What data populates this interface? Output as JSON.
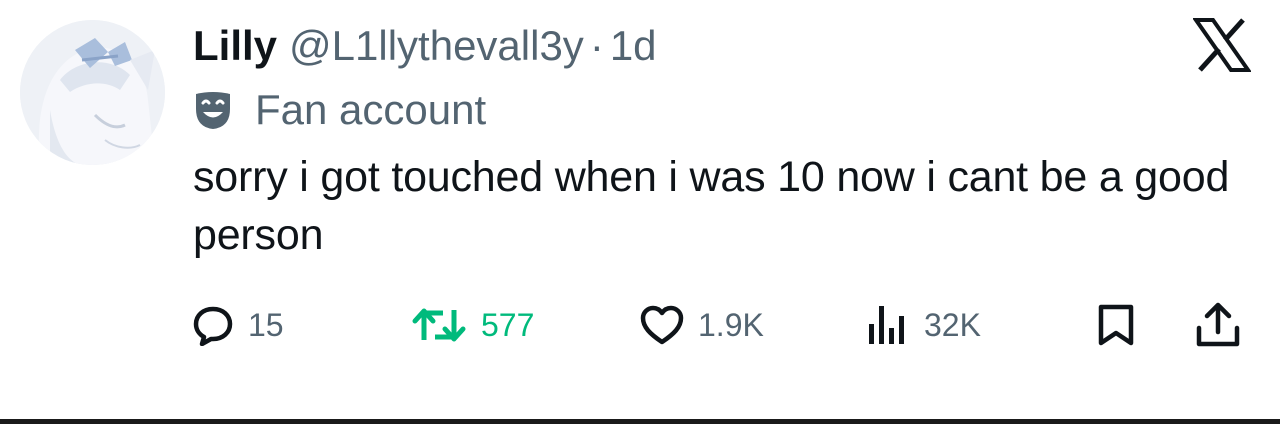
{
  "tweet": {
    "author": {
      "display_name": "Lilly",
      "handle": "@L1llythevall3y",
      "separator": "·",
      "timestamp": "1d",
      "label": "Fan account",
      "avatar_icon": "anime-avatar-image"
    },
    "text": "sorry i got touched when i was 10 now i cant be a good person",
    "actions": {
      "replies": "15",
      "reposts": "577",
      "likes": "1.9K",
      "views": "32K"
    },
    "colors": {
      "text_primary": "#0f1419",
      "text_secondary": "#536471",
      "repost_active": "#00ba7c"
    },
    "icons": {
      "brand": "x-logo-icon",
      "label": "theater-mask-icon",
      "reply": "reply-icon",
      "repost": "repost-icon",
      "like": "heart-icon",
      "views": "views-icon",
      "bookmark": "bookmark-icon",
      "share": "share-icon"
    }
  }
}
